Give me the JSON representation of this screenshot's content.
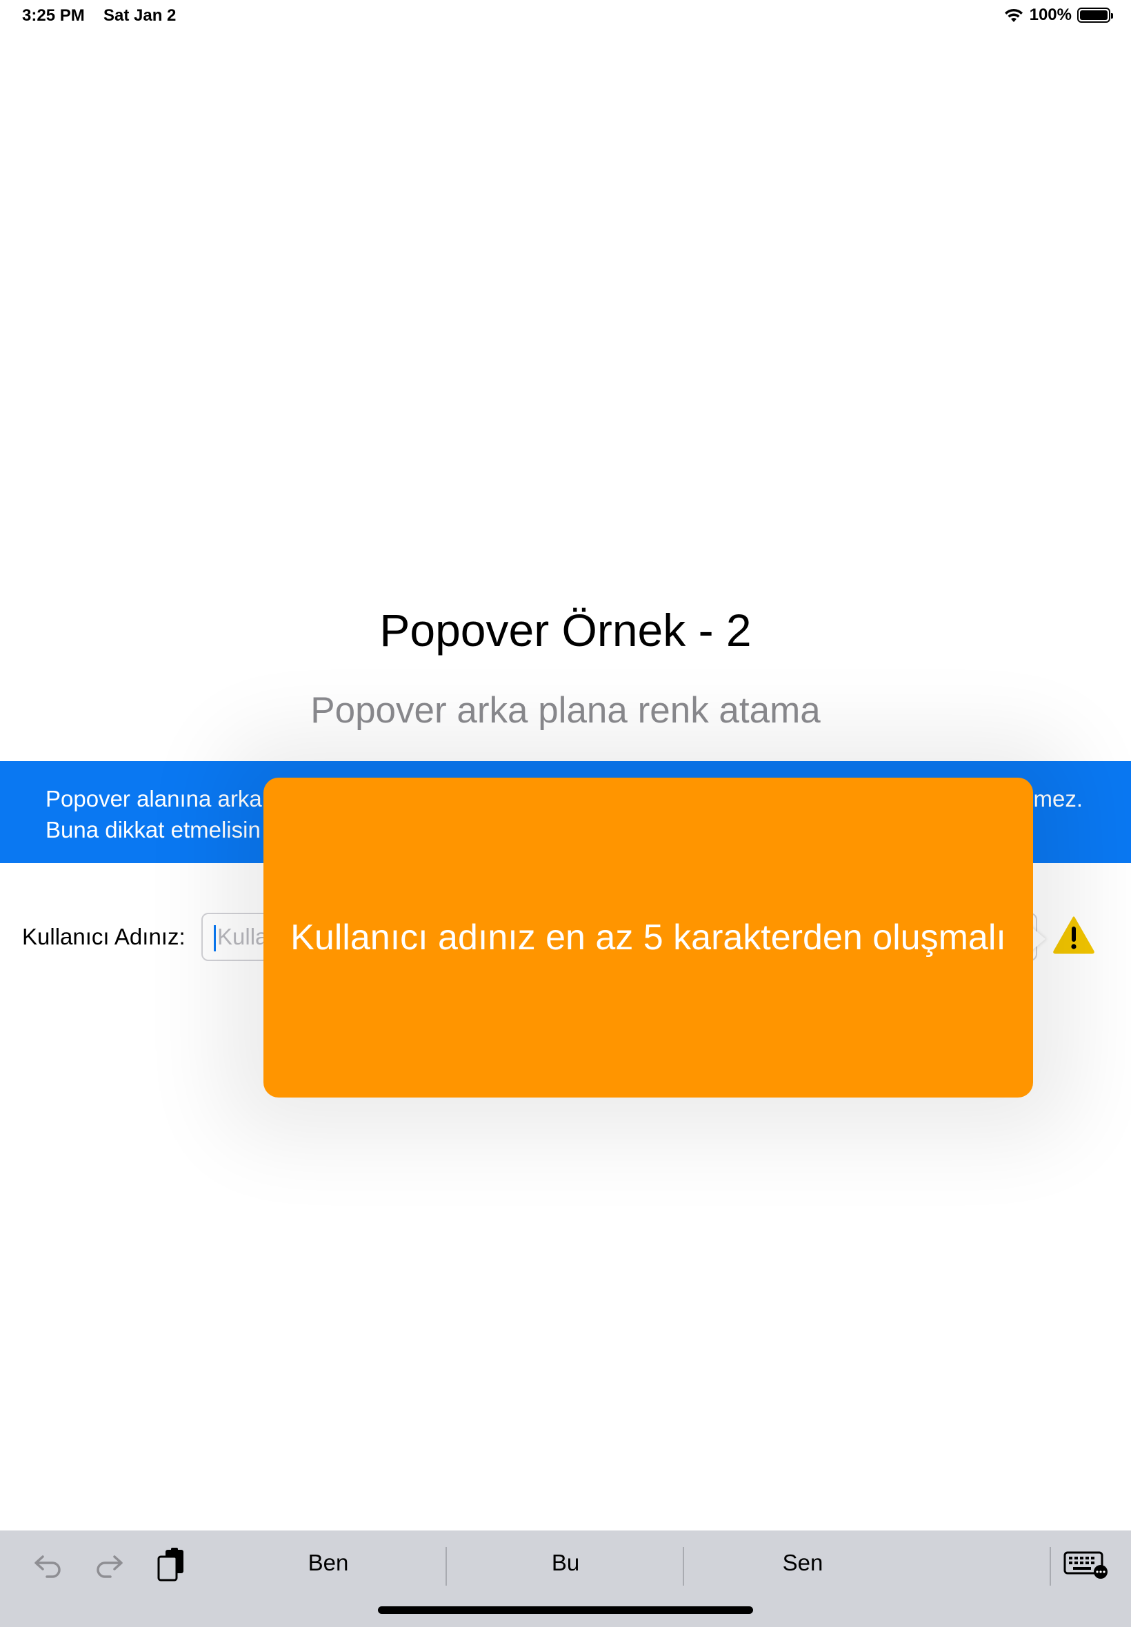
{
  "status_bar": {
    "time": "3:25 PM",
    "date": "Sat Jan 2",
    "battery": "100%"
  },
  "page": {
    "title": "Popover Örnek - 2",
    "subtitle": "Popover arka plana renk atama"
  },
  "info_banner": {
    "line1_visible": "Popover alanına arka",
    "line1_tail": "mez.",
    "line2_visible": "Buna dikkat etmelisin",
    "background": "#0A78F2"
  },
  "form": {
    "username_label": "Kullanıcı Adınız:",
    "username_placeholder_visible": "Kulla"
  },
  "popover": {
    "message": "Kullanıcı adınız en az 5 karakterden oluşmalı",
    "background": "#FF9500"
  },
  "warning_icon": {
    "name": "warning-icon",
    "color": "#F2C500"
  },
  "keyboard_bar": {
    "suggestions": [
      "Ben",
      "Bu",
      "Sen"
    ],
    "icons": [
      "undo-icon",
      "redo-icon",
      "paste-icon",
      "keyboard-icon"
    ]
  }
}
